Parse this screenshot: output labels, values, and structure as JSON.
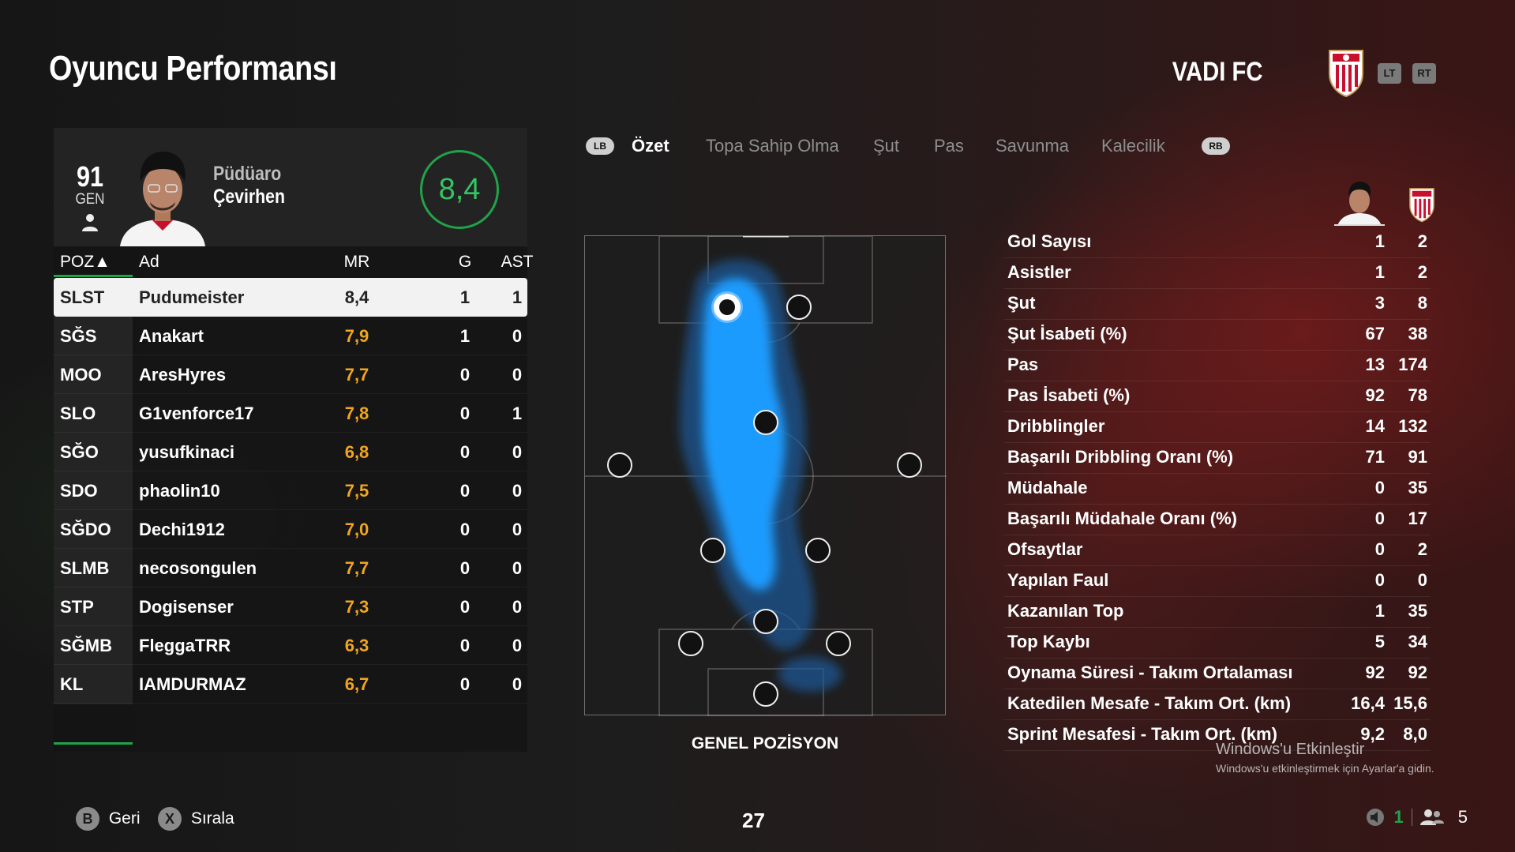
{
  "header": {
    "title": "Oyuncu Performansı",
    "club": "VADI FC",
    "lt": "LT",
    "rt": "RT"
  },
  "player": {
    "overall": "91",
    "overall_label": "GEN",
    "first_name": "Püdüaro",
    "last_name": "Çevirhen",
    "rating": "8,4"
  },
  "table": {
    "headers": {
      "poz": "POZ▲",
      "ad": "Ad",
      "mr": "MR",
      "g": "G",
      "ast": "AST"
    },
    "rows": [
      {
        "poz": "SLST",
        "name": "Pudumeister",
        "mr": "8,4",
        "g": "1",
        "ast": "1"
      },
      {
        "poz": "SĞS",
        "name": "Anakart",
        "mr": "7,9",
        "g": "1",
        "ast": "0"
      },
      {
        "poz": "MOO",
        "name": "AresHyres",
        "mr": "7,7",
        "g": "0",
        "ast": "0"
      },
      {
        "poz": "SLO",
        "name": "G1venforce17",
        "mr": "7,8",
        "g": "0",
        "ast": "1"
      },
      {
        "poz": "SĞO",
        "name": "yusufkinaci",
        "mr": "6,8",
        "g": "0",
        "ast": "0"
      },
      {
        "poz": "SDO",
        "name": "phaolin10",
        "mr": "7,5",
        "g": "0",
        "ast": "0"
      },
      {
        "poz": "SĞDO",
        "name": "Dechi1912",
        "mr": "7,0",
        "g": "0",
        "ast": "0"
      },
      {
        "poz": "SLMB",
        "name": "necosongulen",
        "mr": "7,7",
        "g": "0",
        "ast": "0"
      },
      {
        "poz": "STP",
        "name": "Dogisenser",
        "mr": "7,3",
        "g": "0",
        "ast": "0"
      },
      {
        "poz": "SĞMB",
        "name": "FleggaTRR",
        "mr": "6,3",
        "g": "0",
        "ast": "0"
      },
      {
        "poz": "KL",
        "name": "IAMDURMAZ",
        "mr": "6,7",
        "g": "0",
        "ast": "0"
      }
    ]
  },
  "tabs": {
    "lb": "LB",
    "rb": "RB",
    "items": [
      "Özet",
      "Topa Sahip Olma",
      "Şut",
      "Pas",
      "Savunma",
      "Kalecilik"
    ],
    "active": "Özet"
  },
  "pitch": {
    "label": "GENEL POZİSYON"
  },
  "stats": [
    {
      "label": "Gol Sayısı",
      "player": "1",
      "team": "2"
    },
    {
      "label": "Asistler",
      "player": "1",
      "team": "2"
    },
    {
      "label": "Şut",
      "player": "3",
      "team": "8"
    },
    {
      "label": "Şut İsabeti (%)",
      "player": "67",
      "team": "38"
    },
    {
      "label": "Pas",
      "player": "13",
      "team": "174"
    },
    {
      "label": "Pas İsabeti (%)",
      "player": "92",
      "team": "78"
    },
    {
      "label": "Dribblingler",
      "player": "14",
      "team": "132"
    },
    {
      "label": "Başarılı Dribbling Oranı (%)",
      "player": "71",
      "team": "91"
    },
    {
      "label": "Müdahale",
      "player": "0",
      "team": "35"
    },
    {
      "label": "Başarılı Müdahale Oranı (%)",
      "player": "0",
      "team": "17"
    },
    {
      "label": "Ofsaytlar",
      "player": "0",
      "team": "2"
    },
    {
      "label": "Yapılan Faul",
      "player": "0",
      "team": "0"
    },
    {
      "label": "Kazanılan Top",
      "player": "1",
      "team": "35"
    },
    {
      "label": "Top Kaybı",
      "player": "5",
      "team": "34"
    },
    {
      "label": "Oynama Süresi - Takım Ortalaması",
      "player": "92",
      "team": "92"
    },
    {
      "label": "Katedilen Mesafe - Takım Ort. (km)",
      "player": "16,4",
      "team": "15,6"
    },
    {
      "label": "Sprint Mesafesi - Takım Ort. (km)",
      "player": "9,2",
      "team": "8,0"
    }
  ],
  "watermark": {
    "line1": "Windows'u Etkinleştir",
    "line2": "Windows'u etkinleştirmek için Ayarlar'a gidin."
  },
  "footer": {
    "back_btn": "B",
    "back_label": "Geri",
    "sort_btn": "X",
    "sort_label": "Sırala",
    "page": "27",
    "count1": "1",
    "count2": "5"
  },
  "colors": {
    "accent_green": "#1fa34a",
    "rating_orange": "#f2a51f",
    "heat_blue": "#1e9bff"
  }
}
